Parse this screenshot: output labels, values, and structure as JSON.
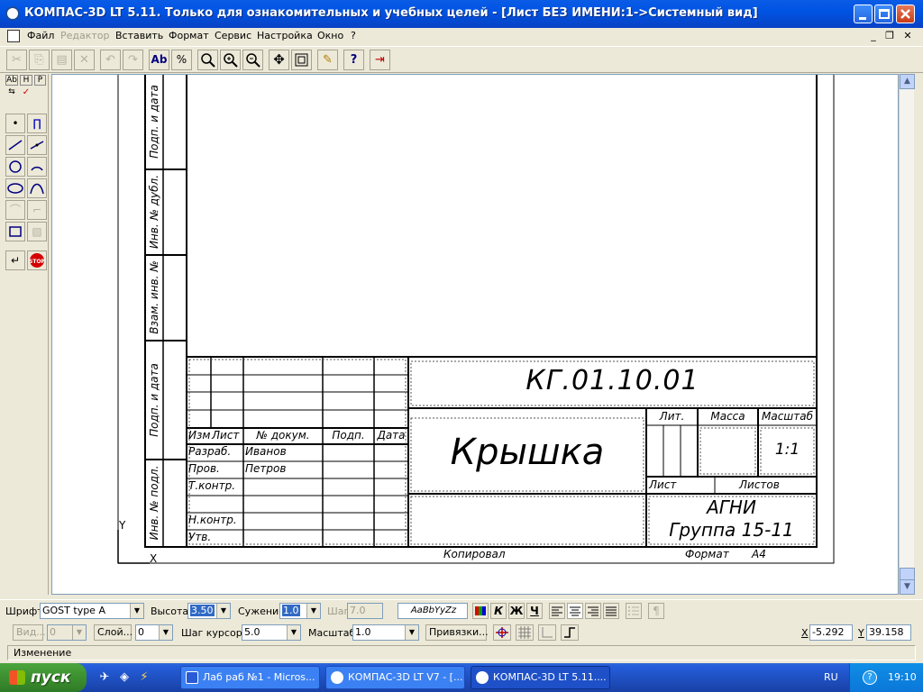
{
  "window": {
    "title": "КОМПАС-3D LT 5.11. Только для ознакомительных и учебных целей - [Лист БЕЗ ИМЕНИ:1->Системный вид]"
  },
  "menu": {
    "items": [
      {
        "label": "Файл",
        "enabled": true
      },
      {
        "label": "Редактор",
        "enabled": false
      },
      {
        "label": "Вставить",
        "enabled": true
      },
      {
        "label": "Формат",
        "enabled": true
      },
      {
        "label": "Сервис",
        "enabled": true
      },
      {
        "label": "Настройка",
        "enabled": true
      },
      {
        "label": "Окно",
        "enabled": true
      },
      {
        "label": "?",
        "enabled": true
      }
    ]
  },
  "toolbar": {
    "text_btn_label": "Ab",
    "spell_btn_label": "%",
    "help_btn_label": "?"
  },
  "lefttools": {
    "tab_labels": [
      "Ab",
      "H",
      "P"
    ]
  },
  "drawing": {
    "stamp_left": [
      "Подп. и дата",
      "Инв. № дубл.",
      "Взам. инв. №",
      "Подп. и дата",
      "Инв. № подл."
    ],
    "designation": "КГ.01.10.01",
    "part_name": "Крышка",
    "headers": {
      "izm": "Изм",
      "list": "Лист",
      "ndoc": "№ докум.",
      "podp": "Подп.",
      "data": "Дата"
    },
    "rows": [
      {
        "role": "Разраб.",
        "name": "Иванов"
      },
      {
        "role": "Пров.",
        "name": "Петров"
      },
      {
        "role": "Т.контр.",
        "name": ""
      },
      {
        "role": "",
        "name": ""
      },
      {
        "role": "Н.контр.",
        "name": ""
      },
      {
        "role": "Утв.",
        "name": ""
      }
    ],
    "lit_label": "Лит.",
    "mass_label": "Масса",
    "scale_label": "Масштаб",
    "scale_value": "1:1",
    "sheet_label": "Лист",
    "sheets_label": "Листов",
    "org_line1": "АГНИ",
    "org_line2": "Группа 15-11",
    "copied_label": "Копировал",
    "format_label": "Формат",
    "format_value": "А4",
    "axis_x": "X",
    "axis_y": "Y"
  },
  "props": {
    "font_label": "Шрифт",
    "font_value": "GOST type A",
    "height_label": "Высота",
    "height_value": "3.50",
    "compress_label": "Сужение",
    "compress_value": "1.0",
    "step_label": "Шаг",
    "step_value": "7.0",
    "preview": "AaBbYyZz",
    "italic_btn": "К",
    "bold_btn": "Ж",
    "underline_btn": "Ч",
    "para_btn": "¶"
  },
  "props2": {
    "view_label": "Вид...",
    "view_value": "0",
    "layer_label": "Слой...",
    "layer_value": "0",
    "cursor_step_label": "Шаг курсора",
    "cursor_step_value": "5.0",
    "scale_label": "Масштаб",
    "scale_value": "1.0",
    "snap_label": "Привязки...",
    "x_label": "X",
    "x_value": "-5.292",
    "y_label": "Y",
    "y_value": "39.158"
  },
  "status": {
    "text": "Изменение"
  },
  "taskbar": {
    "start_label": "пуск",
    "tasks": [
      {
        "label": "Лаб раб №1 - Micros...",
        "active": false,
        "icon_color": "#2a5bd7"
      },
      {
        "label": "КОМПАС-3D LT V7 - [...",
        "active": false,
        "icon_color": "#ffffff"
      },
      {
        "label": "КОМПАС-3D LT 5.11....",
        "active": true,
        "icon_color": "#ffffff"
      }
    ],
    "lang": "RU",
    "clock": "19:10"
  },
  "colors": {
    "titlebar": "#0054e3",
    "taskbar": "#245edb",
    "start": "#3c8f2f"
  }
}
